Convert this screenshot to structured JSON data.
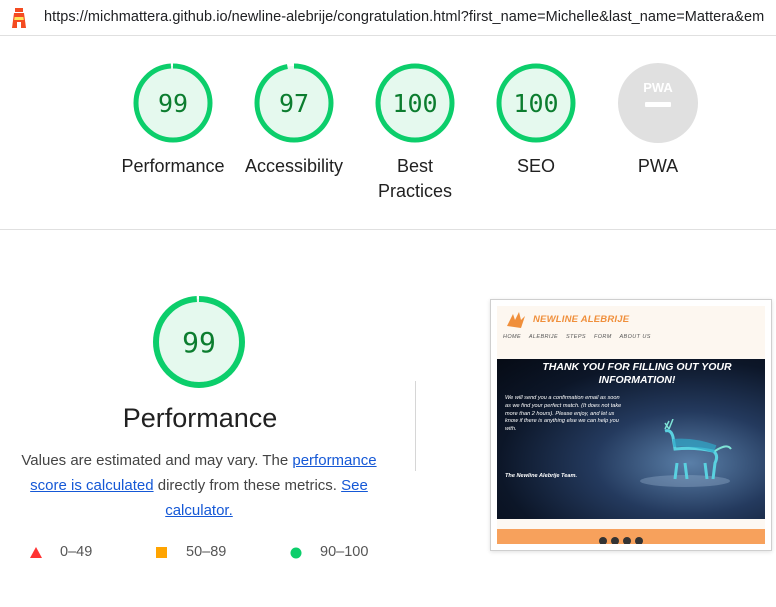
{
  "topbar": {
    "url": "https://michmattera.github.io/newline-alebrije/congratulation.html?first_name=Michelle&last_name=Mattera&em"
  },
  "gauges": [
    {
      "score": "99",
      "label": "Performance"
    },
    {
      "score": "97",
      "label": "Accessibility"
    },
    {
      "score": "100",
      "label": "Best Practices"
    },
    {
      "score": "100",
      "label": "SEO"
    },
    {
      "score": "",
      "label": "PWA",
      "badge": "PWA"
    }
  ],
  "detail": {
    "score": "99",
    "title": "Performance",
    "desc_part1": "Values are estimated and may vary. The ",
    "link1": "performance score is calculated",
    "desc_part2": " directly from these metrics. ",
    "link2": "See calculator."
  },
  "legend": {
    "fail": "0–49",
    "average": "50–89",
    "pass": "90–100"
  },
  "colors": {
    "pass": "#0cce6b",
    "pass_bg": "#e5f9ee",
    "pass_text": "#0c7d2f",
    "average": "#ffa400",
    "fail": "#ff3333",
    "na": "#e0e0e0"
  },
  "thumbnail": {
    "brand": "NEWLINE ALEBRIJE",
    "nav": [
      "HOME",
      "ALEBRIJE",
      "STEPS",
      "FORM",
      "ABOUT US"
    ],
    "hero_title": "THANK YOU FOR FILLING OUT YOUR INFORMATION!",
    "hero_text": "We will send you a confirmation email as soon as we find your perfect match. (It does not take more than 2 hours). Please enjoy, and let us know if there is anything else we can help you with.",
    "hero_sign": "The Newline Alebrije Team.",
    "footer_icons": [
      "instagram-icon",
      "facebook-icon",
      "youtube-icon",
      "github-icon"
    ]
  }
}
